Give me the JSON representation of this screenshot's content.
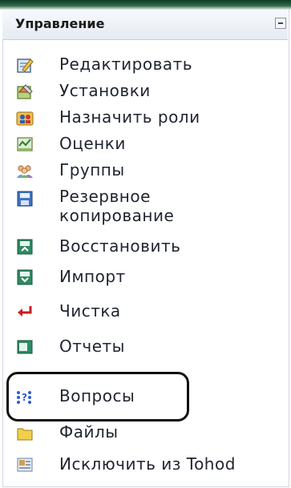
{
  "block": {
    "title": "Управление",
    "collapse_icon": "minus-box-icon"
  },
  "items": [
    {
      "label": "Редактировать",
      "icon": "edit-icon"
    },
    {
      "label": "Установки",
      "icon": "settings-icon"
    },
    {
      "label": "Назначить роли",
      "icon": "roles-icon"
    },
    {
      "label": "Оценки",
      "icon": "grades-icon"
    },
    {
      "label": "Группы",
      "icon": "groups-icon"
    },
    {
      "label": "Резервное копирование",
      "icon": "backup-icon"
    },
    {
      "label": "Восстановить",
      "icon": "restore-icon"
    },
    {
      "label": "Импорт",
      "icon": "import-icon"
    },
    {
      "label": "Чистка",
      "icon": "reset-icon"
    },
    {
      "label": "Отчеты",
      "icon": "reports-icon"
    },
    {
      "label": "Вопросы",
      "icon": "questions-icon"
    },
    {
      "label": "Файлы",
      "icon": "files-icon"
    },
    {
      "label": "Исключить из Tohod",
      "icon": "unenrol-icon"
    }
  ],
  "colors": {
    "topbar": "#1f5a3a",
    "header_bg": "#e9eef5",
    "text": "#1f2430",
    "highlight_border": "#111111"
  }
}
